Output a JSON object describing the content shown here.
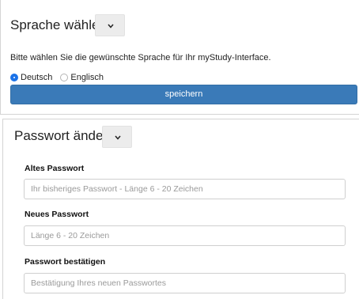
{
  "language_section": {
    "title": "Sprache wählen",
    "description": "Bitte wählen Sie die gewünschte Sprache für Ihr myStudy-Interface.",
    "options": [
      {
        "label": "Deutsch",
        "selected": true
      },
      {
        "label": "Englisch",
        "selected": false
      }
    ],
    "save_label": "speichern",
    "button_color": "#3a7ab8",
    "radio_color": "#1a72e8"
  },
  "password_section": {
    "title": "Passwort ändern",
    "fields": [
      {
        "label": "Altes Passwort",
        "placeholder": "Ihr bisheriges Passwort - Länge 6 - 20 Zeichen"
      },
      {
        "label": "Neues Passwort",
        "placeholder": "Länge 6 - 20 Zeichen"
      },
      {
        "label": "Passwort bestätigen",
        "placeholder": "Bestätigung Ihres neuen Passwortes"
      }
    ]
  },
  "icons": {
    "collapse_toggle": "chevron-down-icon"
  }
}
